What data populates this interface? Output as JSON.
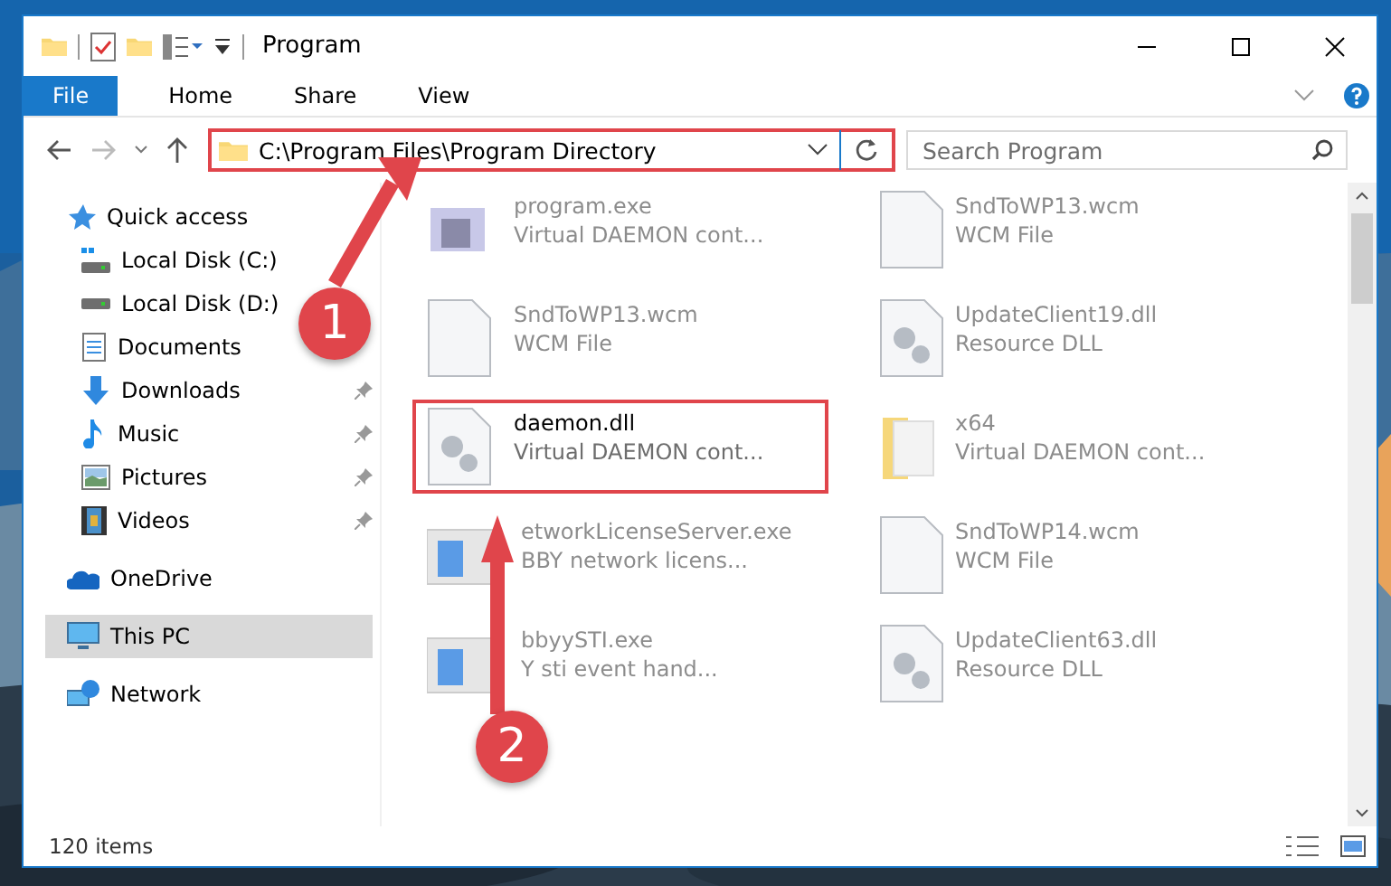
{
  "window": {
    "title": "Program"
  },
  "ribbon": {
    "tabs": [
      {
        "label": "File",
        "kind": "file",
        "selected": false
      },
      {
        "label": "Home",
        "kind": "tab",
        "selected": false
      },
      {
        "label": "Share",
        "kind": "tab",
        "selected": false
      },
      {
        "label": "View",
        "kind": "tab",
        "selected": false
      }
    ]
  },
  "address_bar": {
    "path": "C:\\Program Files\\Program Directory",
    "highlighted": true
  },
  "search": {
    "placeholder": "Search Program"
  },
  "sidebar": {
    "items": [
      {
        "label": "Quick access",
        "selected": false,
        "children": [
          {
            "label": "Local Disk (C:)",
            "pinned": false,
            "selected": false
          },
          {
            "label": "Local Disk (D:)",
            "pinned": false,
            "selected": false
          },
          {
            "label": "Documents",
            "pinned": false,
            "selected": false
          },
          {
            "label": "Downloads",
            "pinned": true,
            "selected": false
          },
          {
            "label": "Music",
            "pinned": true,
            "selected": false
          },
          {
            "label": "Pictures",
            "pinned": true,
            "selected": false
          },
          {
            "label": "Videos",
            "pinned": true,
            "selected": false
          }
        ]
      },
      {
        "label": "OneDrive",
        "selected": false
      },
      {
        "label": "This PC",
        "selected": true
      },
      {
        "label": "Network",
        "selected": false
      }
    ]
  },
  "files": [
    {
      "name": "program.exe",
      "type": "Virtual DAEMON cont...",
      "faded": true,
      "highlighted": false
    },
    {
      "name": "SndToWP13.wcm",
      "type": "WCM File",
      "faded": true,
      "highlighted": false
    },
    {
      "name": "SndToWP13.wcm",
      "type": "WCM File",
      "faded": true,
      "highlighted": false
    },
    {
      "name": "UpdateClient19.dll",
      "type": "Resource DLL",
      "faded": true,
      "highlighted": false
    },
    {
      "name": "daemon.dll",
      "type": "Virtual DAEMON cont...",
      "faded": false,
      "highlighted": true
    },
    {
      "name": "x64",
      "type": "Virtual DAEMON cont...",
      "faded": true,
      "highlighted": false
    },
    {
      "name": "etworkLicenseServer.exe",
      "type": "BBY network licens...",
      "faded": true,
      "highlighted": false
    },
    {
      "name": "SndToWP14.wcm",
      "type": "WCM File",
      "faded": true,
      "highlighted": false
    },
    {
      "name": "bbyySTI.exe",
      "type": "Y sti event hand...",
      "faded": true,
      "highlighted": false
    },
    {
      "name": "UpdateClient63.dll",
      "type": "Resource DLL",
      "faded": true,
      "highlighted": false
    }
  ],
  "status_bar": {
    "items": "120 items"
  },
  "annotations": [
    {
      "label": "1",
      "kind": "up-right"
    },
    {
      "label": "2",
      "kind": "up"
    }
  ]
}
